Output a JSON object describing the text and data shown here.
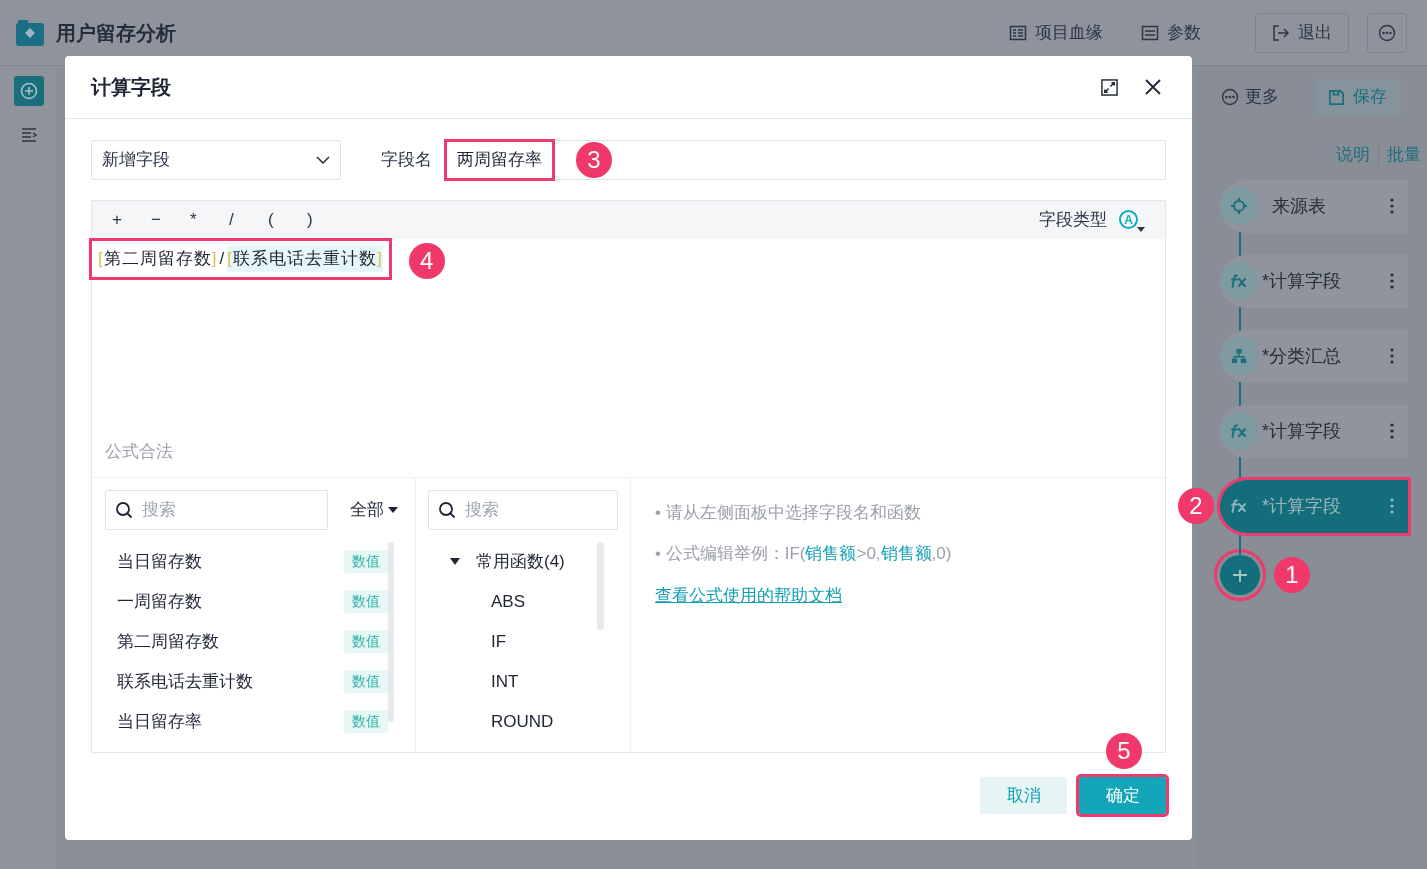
{
  "app": {
    "title": "用户留存分析",
    "header_actions": [
      {
        "kind": "lineage",
        "label": "项目血缘"
      },
      {
        "kind": "params",
        "label": "参数"
      },
      {
        "kind": "exit",
        "label": "退出"
      }
    ]
  },
  "right_panel": {
    "more": "更多",
    "save": "保存",
    "links": [
      "说明",
      "批量"
    ],
    "steps": [
      {
        "kind": "source",
        "label": "来源表",
        "selected": false,
        "highlighted": false
      },
      {
        "kind": "formula",
        "label": "*计算字段",
        "selected": false,
        "highlighted": false
      },
      {
        "kind": "group",
        "label": "*分类汇总",
        "selected": false,
        "highlighted": false
      },
      {
        "kind": "formula",
        "label": "*计算字段",
        "selected": false,
        "highlighted": false
      },
      {
        "kind": "formula",
        "label": "*计算字段",
        "selected": true,
        "highlighted": true
      }
    ],
    "add_highlighted": true
  },
  "dialog": {
    "title": "计算字段",
    "mode": "新增字段",
    "field_name_label": "字段名",
    "field_name": "两周留存率",
    "field_name_highlighted": true,
    "operators": [
      "+",
      "−",
      "*",
      "/",
      "(",
      ")"
    ],
    "field_type_label": "字段类型",
    "field_type_glyph": "A",
    "formula": [
      {
        "kind": "field",
        "open": "[",
        "name": "第二周留存数",
        "close": "]",
        "selected": false
      },
      {
        "kind": "operator",
        "text": "/"
      },
      {
        "kind": "field",
        "open": "[",
        "name": "联系电话去重计数",
        "close": "]",
        "selected": true
      }
    ],
    "formula_highlighted": true,
    "status": "公式合法",
    "fields_search": {
      "placeholder": "搜索"
    },
    "filter": "全部",
    "fields": [
      {
        "name": "当日留存数",
        "type": "数值"
      },
      {
        "name": "一周留存数",
        "type": "数值"
      },
      {
        "name": "第二周留存数",
        "type": "数值"
      },
      {
        "name": "联系电话去重计数",
        "type": "数值"
      },
      {
        "name": "当日留存率",
        "type": "数值"
      }
    ],
    "functions_search": {
      "placeholder": "搜索"
    },
    "function_group": {
      "label": "常用函数(4)",
      "expanded": true,
      "children": [
        {
          "label": "ABS"
        },
        {
          "label": "IF"
        },
        {
          "label": "INT"
        },
        {
          "label": "ROUND"
        }
      ]
    },
    "hints": [
      [
        {
          "kind": "plain",
          "text": "• 请从左侧面板中选择字段名和函数"
        }
      ],
      [
        {
          "kind": "plain",
          "text": "• 公式编辑举例：IF("
        },
        {
          "kind": "field",
          "text": "销售额"
        },
        {
          "kind": "plain",
          "text": ">0,"
        },
        {
          "kind": "field",
          "text": "销售额"
        },
        {
          "kind": "plain",
          "text": ",0)"
        }
      ]
    ],
    "help_link": "查看公式使用的帮助文档",
    "cancel": "取消",
    "confirm": "确定",
    "confirm_highlighted": true
  },
  "annotations": [
    {
      "kind": "add",
      "badge": "1"
    },
    {
      "kind": "step",
      "badge": "2"
    },
    {
      "kind": "name",
      "badge": "3"
    },
    {
      "kind": "formula",
      "badge": "4"
    },
    {
      "kind": "confirm",
      "badge": "5"
    }
  ]
}
